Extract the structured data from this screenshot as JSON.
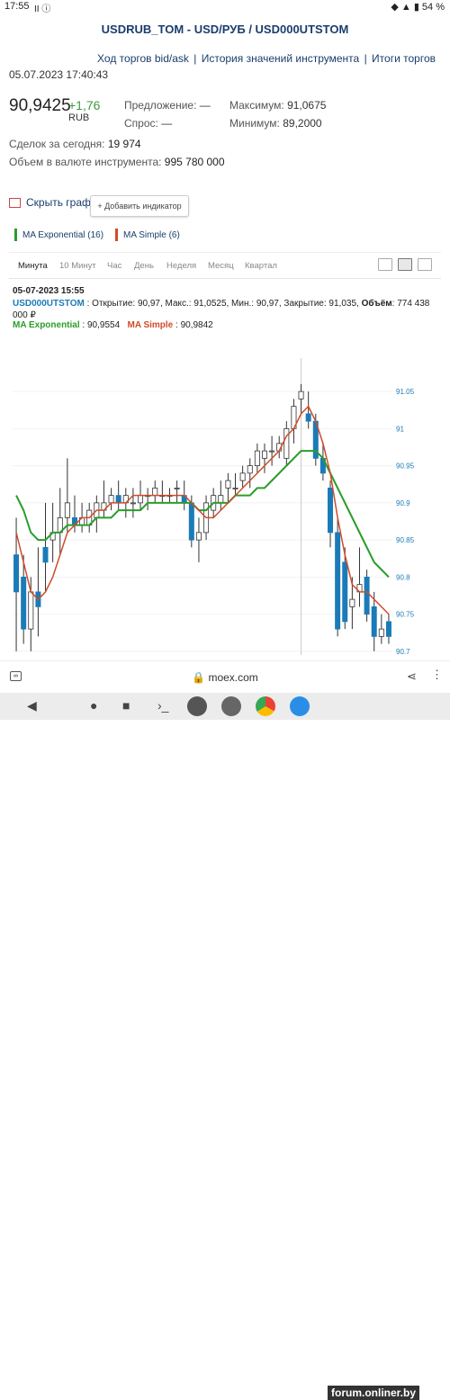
{
  "status": {
    "time": "17:55",
    "icons": "II ⓘ",
    "battery": "◆ ▲ ▮ 54 %"
  },
  "header": {
    "title": "USDRUB_TOM - USD/РУБ / USD000UTSTOM"
  },
  "nav": {
    "links": [
      "Ход торгов bid/ask",
      "История значений инструмента",
      "Итоги торгов"
    ],
    "sep": "|"
  },
  "quote": {
    "datetime": "05.07.2023 17:40:43",
    "price": "90,9425",
    "change": "+1,76",
    "currency": "RUB",
    "offer_label": "Предложение:",
    "offer_value": "—",
    "demand_label": "Спрос:",
    "demand_value": "—",
    "max_label": "Максимум:",
    "max_value": "91,0675",
    "min_label": "Минимум:",
    "min_value": "89,2000"
  },
  "stats": {
    "deals_label": "Сделок за сегодня:",
    "deals_value": "19 974",
    "volume_label": "Объем в валюте инструмента:",
    "volume_value": "995 780 000"
  },
  "controls": {
    "hide_chart": "Скрыть график",
    "add_indicator": "+ Добавить индикатор"
  },
  "legend": [
    {
      "label": "MA Exponential (16)",
      "color": "#2a9d2a"
    },
    {
      "label": "MA Simple (6)",
      "color": "#d14a2a"
    }
  ],
  "tabs": [
    "Минута",
    "10 Минут",
    "Час",
    "День",
    "Неделя",
    "Месяц",
    "Квартал"
  ],
  "active_tab": "Минута",
  "info": {
    "date": "05-07-2023 15:55",
    "symbol": "USD000UTSTOM",
    "details": ": Открытие: 90,97, Макс.: 91,0525, Мин.: 90,97, Закрытие: 91,035,",
    "volume_label": "Объём",
    "volume_value": ": 774 438 000 ₽",
    "ema_label": "MA Exponential",
    "ema_value": ": 90,9554",
    "sma_label": "MA Simple",
    "sma_value": ": 90,9842"
  },
  "browser": {
    "url": "moex.com",
    "tab_count": "∞",
    "share": "⋖",
    "more": "⋮"
  },
  "navbar": {
    "back": "◀",
    "home": "●",
    "recent": "■",
    "term": "›_"
  },
  "watermark": "forum.onliner.by",
  "chart_data": {
    "type": "candlestick",
    "y_ticks": [
      "91.05",
      "91",
      "90.95",
      "90.9",
      "90.85",
      "90.8",
      "90.75",
      "90.7"
    ],
    "ylim": [
      90.695,
      91.095
    ],
    "candles": [
      [
        90.83,
        90.88,
        90.7,
        90.78
      ],
      [
        90.8,
        90.83,
        90.71,
        90.73
      ],
      [
        90.73,
        90.8,
        90.7,
        90.78
      ],
      [
        90.78,
        90.84,
        90.72,
        90.76
      ],
      [
        90.84,
        90.9,
        90.78,
        90.82
      ],
      [
        90.85,
        90.9,
        90.82,
        90.86
      ],
      [
        90.86,
        90.92,
        90.83,
        90.88
      ],
      [
        90.88,
        90.96,
        90.86,
        90.9
      ],
      [
        90.88,
        90.91,
        90.86,
        90.87
      ],
      [
        90.87,
        90.9,
        90.86,
        90.88
      ],
      [
        90.87,
        90.9,
        90.86,
        90.89
      ],
      [
        90.88,
        90.91,
        90.86,
        90.9
      ],
      [
        90.89,
        90.93,
        90.88,
        90.9
      ],
      [
        90.9,
        90.92,
        90.89,
        90.91
      ],
      [
        90.91,
        90.93,
        90.89,
        90.9
      ],
      [
        90.9,
        90.92,
        90.88,
        90.91
      ],
      [
        90.9,
        90.92,
        90.88,
        90.9
      ],
      [
        90.9,
        90.93,
        90.89,
        90.91
      ],
      [
        90.91,
        90.92,
        90.89,
        90.91
      ],
      [
        90.91,
        90.93,
        90.9,
        90.92
      ],
      [
        90.91,
        90.93,
        90.9,
        90.91
      ],
      [
        90.91,
        90.92,
        90.9,
        90.91
      ],
      [
        90.92,
        90.93,
        90.9,
        90.92
      ],
      [
        90.91,
        90.93,
        90.89,
        90.9
      ],
      [
        90.9,
        90.91,
        90.84,
        90.85
      ],
      [
        90.85,
        90.88,
        90.82,
        90.86
      ],
      [
        90.86,
        90.91,
        90.85,
        90.9
      ],
      [
        90.89,
        90.92,
        90.88,
        90.91
      ],
      [
        90.9,
        90.93,
        90.89,
        90.91
      ],
      [
        90.92,
        90.94,
        90.9,
        90.93
      ],
      [
        90.92,
        90.94,
        90.91,
        90.92
      ],
      [
        90.93,
        90.95,
        90.92,
        90.94
      ],
      [
        90.94,
        90.96,
        90.92,
        90.95
      ],
      [
        90.95,
        90.98,
        90.94,
        90.97
      ],
      [
        90.96,
        90.98,
        90.94,
        90.97
      ],
      [
        90.97,
        90.99,
        90.95,
        90.97
      ],
      [
        90.97,
        90.99,
        90.96,
        90.98
      ],
      [
        90.96,
        91.01,
        90.95,
        91.0
      ],
      [
        91.0,
        91.04,
        90.98,
        91.03
      ],
      [
        91.04,
        91.06,
        91.02,
        91.05
      ],
      [
        91.02,
        91.05,
        91.0,
        91.01
      ],
      [
        91.01,
        91.02,
        90.95,
        90.96
      ],
      [
        90.96,
        90.98,
        90.93,
        90.94
      ],
      [
        90.92,
        90.93,
        90.84,
        90.86
      ],
      [
        90.86,
        90.88,
        90.72,
        90.73
      ],
      [
        90.82,
        90.84,
        90.73,
        90.74
      ],
      [
        90.76,
        90.8,
        90.73,
        90.77
      ],
      [
        90.78,
        90.84,
        90.76,
        90.79
      ],
      [
        90.8,
        90.81,
        90.74,
        90.75
      ],
      [
        90.76,
        90.78,
        90.7,
        90.72
      ],
      [
        90.72,
        90.75,
        90.71,
        90.73
      ],
      [
        90.74,
        90.75,
        90.71,
        90.72
      ]
    ],
    "series": [
      {
        "name": "MA Exponential (16)",
        "color": "#2a9d2a",
        "values": [
          90.91,
          90.89,
          90.86,
          90.85,
          90.85,
          90.86,
          90.86,
          90.87,
          90.87,
          90.87,
          90.87,
          90.88,
          90.88,
          90.88,
          90.89,
          90.89,
          90.89,
          90.89,
          90.9,
          90.9,
          90.9,
          90.9,
          90.9,
          90.9,
          90.9,
          90.89,
          90.89,
          90.9,
          90.9,
          90.9,
          90.91,
          90.91,
          90.91,
          90.92,
          90.92,
          90.93,
          90.94,
          90.95,
          90.96,
          90.97,
          90.97,
          90.97,
          90.96,
          90.94,
          90.92,
          90.9,
          90.88,
          90.86,
          90.84,
          90.82,
          90.81,
          90.8
        ]
      },
      {
        "name": "MA Simple (6)",
        "color": "#d14a2a",
        "values": [
          90.86,
          90.82,
          90.78,
          90.77,
          90.78,
          90.8,
          90.83,
          90.86,
          90.87,
          90.88,
          90.88,
          90.89,
          90.89,
          90.9,
          90.9,
          90.9,
          90.91,
          90.91,
          90.91,
          90.91,
          90.91,
          90.91,
          90.91,
          90.91,
          90.9,
          90.89,
          90.88,
          90.88,
          90.89,
          90.9,
          90.91,
          90.92,
          90.93,
          90.94,
          90.95,
          90.96,
          90.97,
          90.99,
          91.0,
          91.02,
          91.03,
          91.01,
          90.98,
          90.94,
          90.88,
          90.83,
          90.79,
          90.78,
          90.78,
          90.77,
          90.76,
          90.75
        ]
      }
    ]
  }
}
